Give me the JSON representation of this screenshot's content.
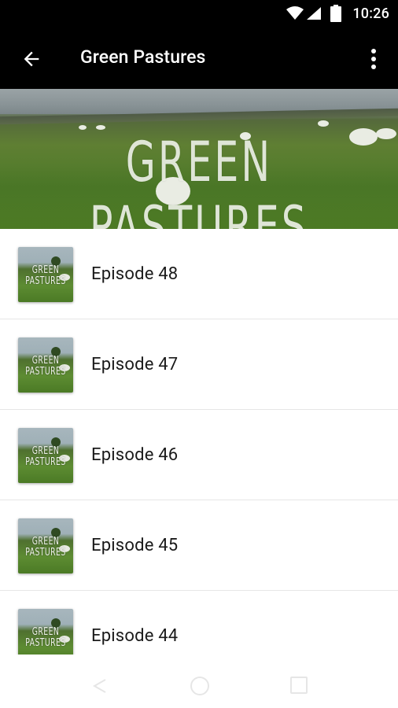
{
  "status_bar": {
    "time": "10:26"
  },
  "toolbar": {
    "title": "Green Pastures"
  },
  "hero": {
    "title": "GREEN PASTURES"
  },
  "thumbnail_text": {
    "line1": "GREEN",
    "line2": "PASTURES"
  },
  "episodes": [
    {
      "title": "Episode 48"
    },
    {
      "title": "Episode 47"
    },
    {
      "title": "Episode 46"
    },
    {
      "title": "Episode 45"
    },
    {
      "title": "Episode 44"
    }
  ],
  "icons": {
    "back": "arrow-back-icon",
    "more": "more-vert-icon",
    "wifi": "wifi-icon",
    "signal": "cell-signal-icon",
    "battery": "battery-icon"
  },
  "colors": {
    "bar": "#000000",
    "background": "#ffffff",
    "divider": "#e6e6e6"
  }
}
